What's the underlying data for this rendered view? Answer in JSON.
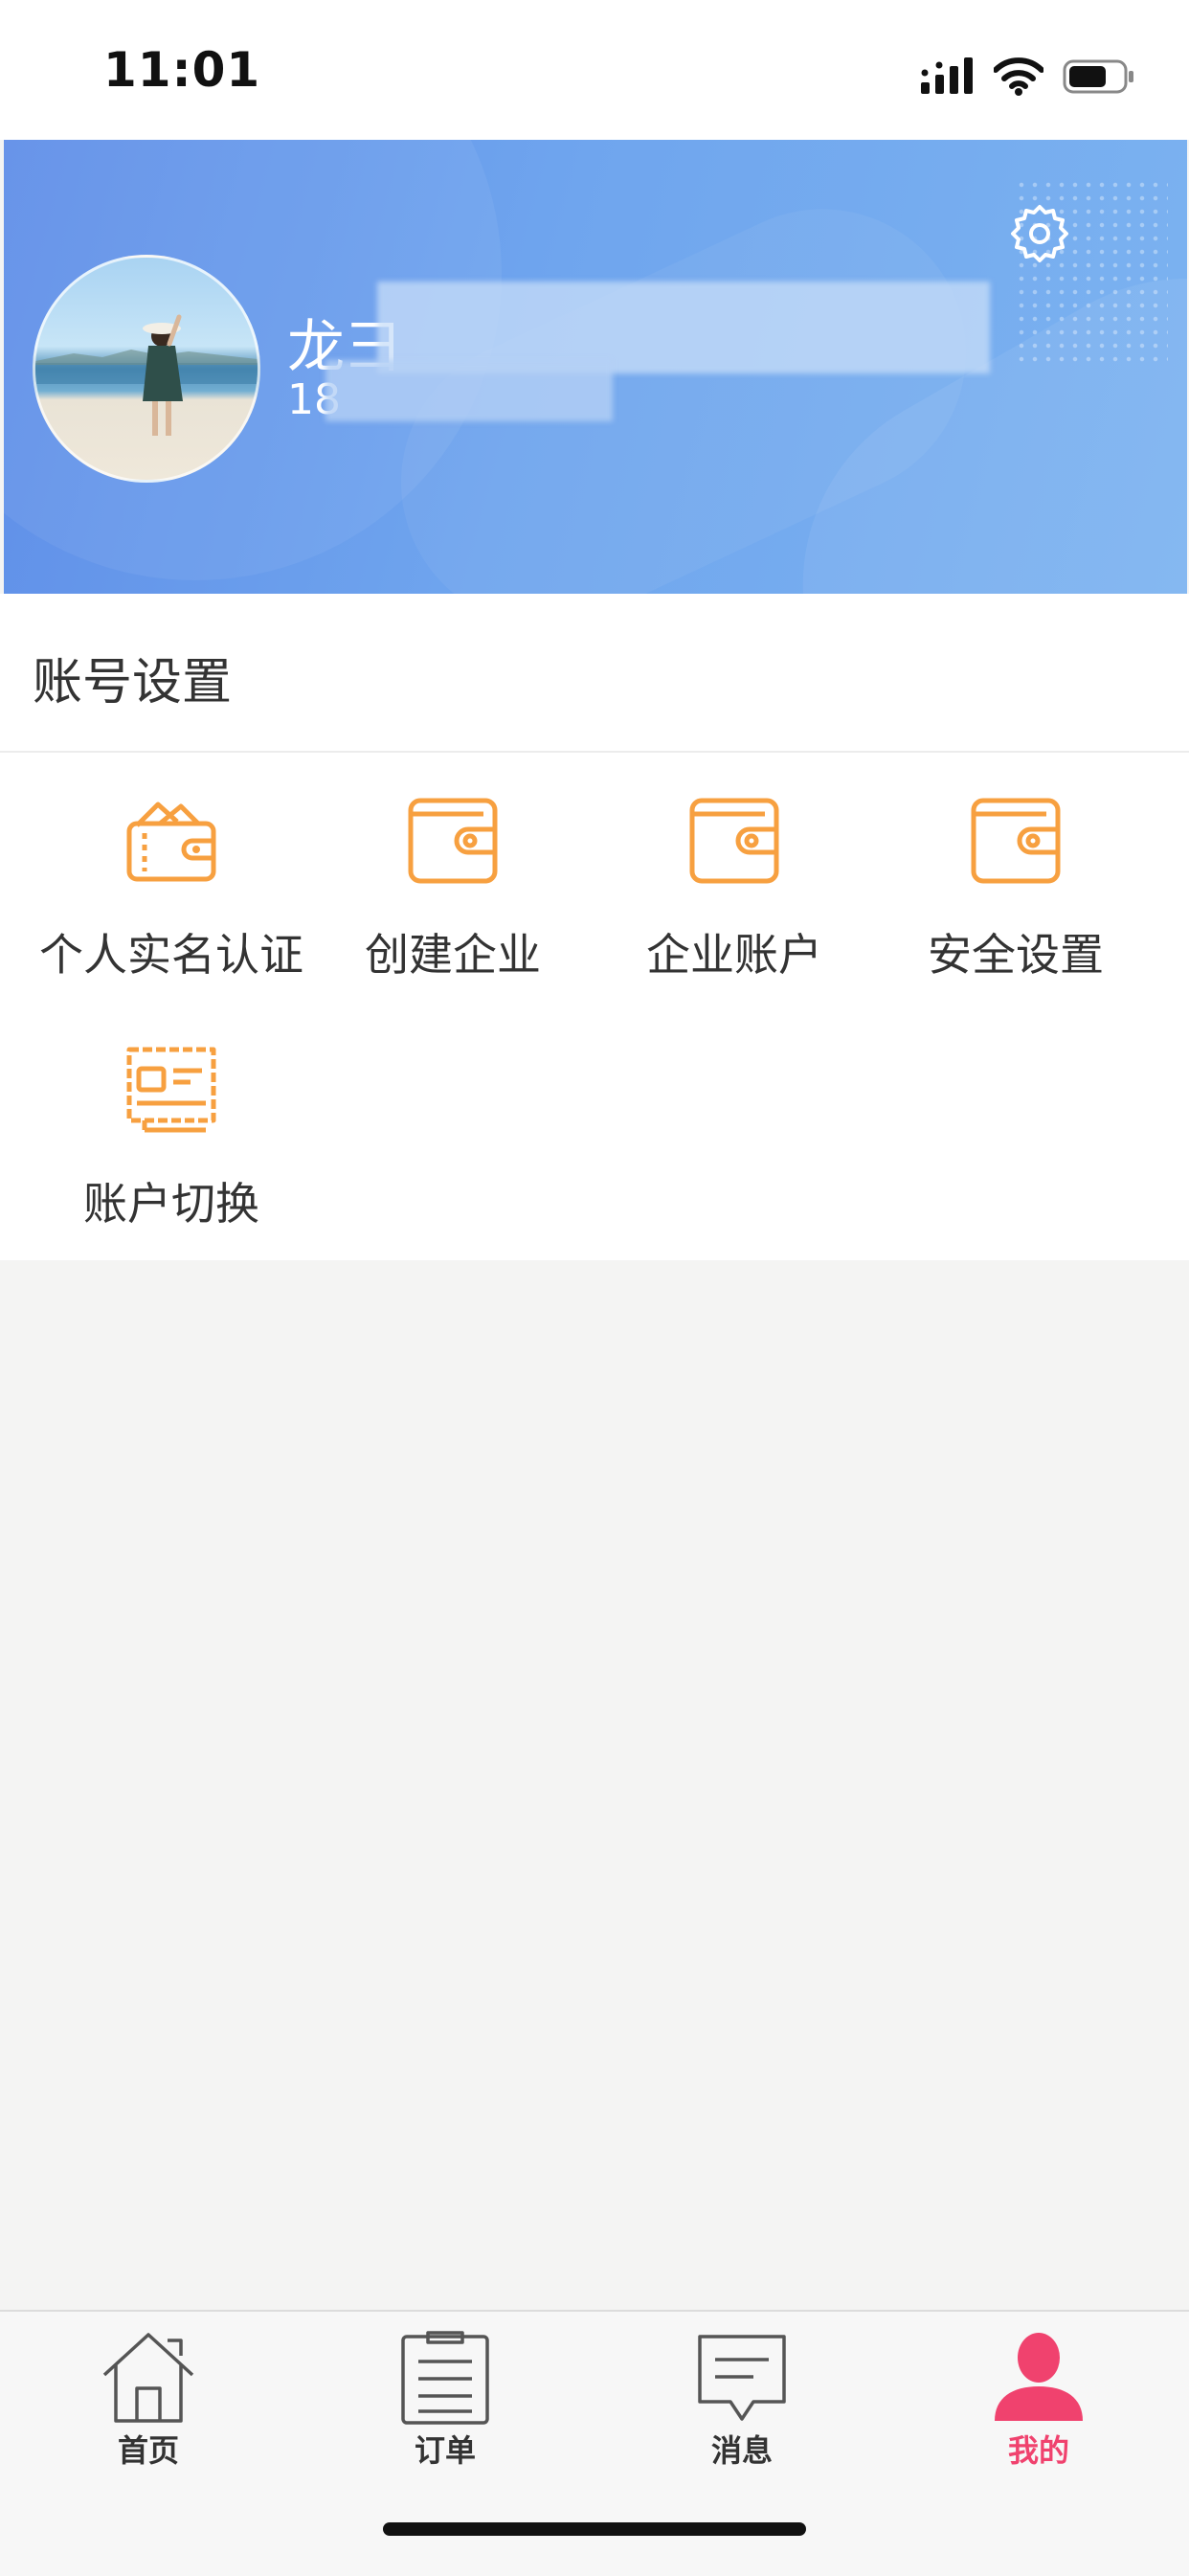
{
  "status_bar": {
    "time": "11:01"
  },
  "profile": {
    "name": "龙⺕",
    "phone": "18"
  },
  "section": {
    "title": "账号设置"
  },
  "grid_items": [
    {
      "label": "个人实名认证",
      "icon": "wallet-cards-icon"
    },
    {
      "label": "创建企业",
      "icon": "wallet-icon"
    },
    {
      "label": "企业账户",
      "icon": "wallet-icon"
    },
    {
      "label": "安全设置",
      "icon": "wallet-icon"
    },
    {
      "label": "账户切换",
      "icon": "id-card-icon"
    }
  ],
  "tabs": [
    {
      "label": "首页",
      "icon": "home-icon",
      "active": false
    },
    {
      "label": "订单",
      "icon": "clipboard-icon",
      "active": false
    },
    {
      "label": "消息",
      "icon": "message-icon",
      "active": false
    },
    {
      "label": "我的",
      "icon": "user-icon",
      "active": true
    }
  ],
  "colors": {
    "accent_orange": "#f7a040",
    "active_tab": "#f0426e",
    "header_blue": "#6fa5ee"
  }
}
